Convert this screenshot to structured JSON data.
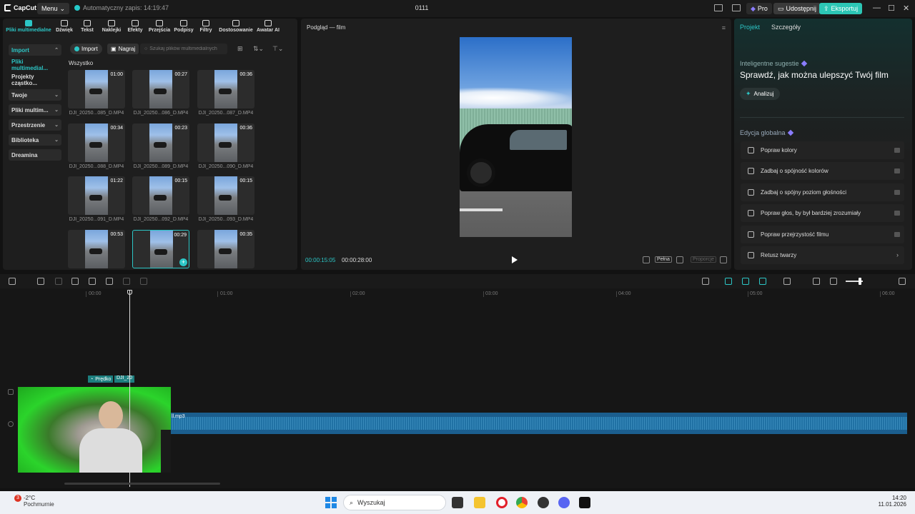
{
  "titlebar": {
    "app_logo": "CapCut",
    "menu_label": "Menu",
    "autosave_label": "Automatyczny zapis: 14:19:47",
    "project_name": "0111",
    "pro_label": "Pro",
    "share_label": "Udostępnij",
    "export_label": "Eksportuj"
  },
  "tool_tabs": [
    {
      "label": "Pliki multimedialne",
      "icon": "media-icon"
    },
    {
      "label": "Dźwięk",
      "icon": "audio-icon"
    },
    {
      "label": "Tekst",
      "icon": "text-icon"
    },
    {
      "label": "Naklejki",
      "icon": "sticker-icon"
    },
    {
      "label": "Efekty",
      "icon": "effects-icon"
    },
    {
      "label": "Przejścia",
      "icon": "transitions-icon"
    },
    {
      "label": "Podpisy",
      "icon": "captions-icon"
    },
    {
      "label": "Filtry",
      "icon": "filters-icon"
    },
    {
      "label": "Dostosowanie",
      "icon": "adjust-icon"
    },
    {
      "label": "Awatar AI",
      "icon": "avatar-icon"
    }
  ],
  "side_nav": [
    {
      "label": "Import"
    },
    {
      "label": "Pliki multimedial..."
    },
    {
      "label": "Projekty cząstko..."
    },
    {
      "label": "Twoje"
    },
    {
      "label": "Pliki multim..."
    },
    {
      "label": "Przestrzenie"
    },
    {
      "label": "Biblioteka"
    },
    {
      "label": "Dreamina"
    }
  ],
  "media_toolbar": {
    "import_label": "Import",
    "record_label": "Nagraj",
    "search_placeholder": "Szukaj plików multimedialnych"
  },
  "media_section_label": "Wszystko",
  "media_items": [
    {
      "duration": "01:00",
      "name": "DJI_20250...085_D.MP4"
    },
    {
      "duration": "00:27",
      "name": "DJI_20250...086_D.MP4"
    },
    {
      "duration": "00:36",
      "name": "DJI_20250...087_D.MP4"
    },
    {
      "duration": "00:34",
      "name": "DJI_20250...088_D.MP4"
    },
    {
      "duration": "00:23",
      "name": "DJI_20250...089_D.MP4"
    },
    {
      "duration": "00:36",
      "name": "DJI_20250...090_D.MP4"
    },
    {
      "duration": "01:22",
      "name": "DJI_20250...091_D.MP4"
    },
    {
      "duration": "00:15",
      "name": "DJI_20250...092_D.MP4"
    },
    {
      "duration": "00:15",
      "name": "DJI_20250...093_D.MP4"
    },
    {
      "duration": "00:53",
      "name": ""
    },
    {
      "duration": "00:29",
      "name": ""
    },
    {
      "duration": "00:35",
      "name": ""
    }
  ],
  "preview": {
    "title": "Podgląd — film",
    "current_time": "00:00:15:05",
    "total_time": "00:00:28:00",
    "full_label": "Pełna",
    "ratio_label": "Proporcje"
  },
  "right_panel": {
    "tab_project": "Projekt",
    "tab_details": "Szczegóły",
    "smart_label": "Inteligentne sugestie",
    "smart_heading": "Sprawdź, jak można ulepszyć Twój film",
    "analyze_label": "Analizuj",
    "global_label": "Edycja globalna",
    "options": [
      {
        "label": "Popraw kolory",
        "icon": "magic-wand-icon"
      },
      {
        "label": "Zadbaj o spójność kolorów",
        "icon": "color-match-icon"
      },
      {
        "label": "Zadbaj o spójny poziom głośności",
        "icon": "volume-levels-icon"
      },
      {
        "label": "Popraw głos, by był bardziej zrozumiały",
        "icon": "voice-wave-icon"
      },
      {
        "label": "Popraw przejrzystość filmu",
        "icon": "hd-icon"
      },
      {
        "label": "Retusz twarzy",
        "icon": "face-retouch-icon"
      }
    ]
  },
  "timeline": {
    "ticks": [
      "00:00",
      "01:00",
      "02:00",
      "03:00",
      "04:00",
      "05:00",
      "06:00"
    ],
    "clip_label_1": "Prędko",
    "clip_label_2": "DJI_20",
    "audio_name": "ll.mp3"
  },
  "taskbar": {
    "temperature": "-2°C",
    "condition": "Pochmurnie",
    "weather_badge": "3",
    "search_placeholder": "Wyszukaj",
    "time": "14:20",
    "date": "11.01.2026"
  },
  "colors": {
    "accent": "#2cc6c6",
    "export_button": "#2cc6b5",
    "audio_track": "#1b5e8e"
  }
}
